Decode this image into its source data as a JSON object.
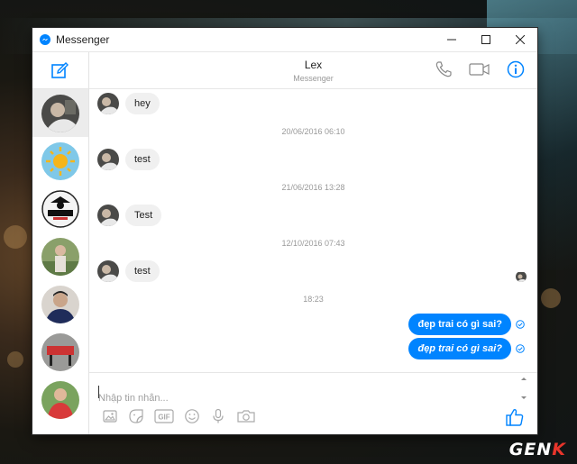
{
  "window": {
    "title": "Messenger"
  },
  "chat": {
    "name": "Lex",
    "subtitle": "Messenger"
  },
  "messages": [
    {
      "kind": "in",
      "text": "hey"
    },
    {
      "kind": "time",
      "text": "20/06/2016 06:10"
    },
    {
      "kind": "in",
      "text": "test"
    },
    {
      "kind": "time",
      "text": "21/06/2016 13:28"
    },
    {
      "kind": "in",
      "text": "Test"
    },
    {
      "kind": "time",
      "text": "12/10/2016 07:43"
    },
    {
      "kind": "in",
      "text": "test"
    },
    {
      "kind": "time",
      "text": "18:23"
    },
    {
      "kind": "out",
      "text": "đẹp trai có gì sai?"
    },
    {
      "kind": "out",
      "text": "đẹp trai có gì sai?"
    }
  ],
  "composer": {
    "placeholder": "Nhập tin nhắn..."
  },
  "toolbar": {
    "gif_label": "GIF"
  },
  "watermark": {
    "text_a": "GEN",
    "text_b": "K"
  },
  "colors": {
    "accent": "#0084ff",
    "incoming_bubble": "#f0f0f0",
    "active_contact": "#ececec"
  }
}
